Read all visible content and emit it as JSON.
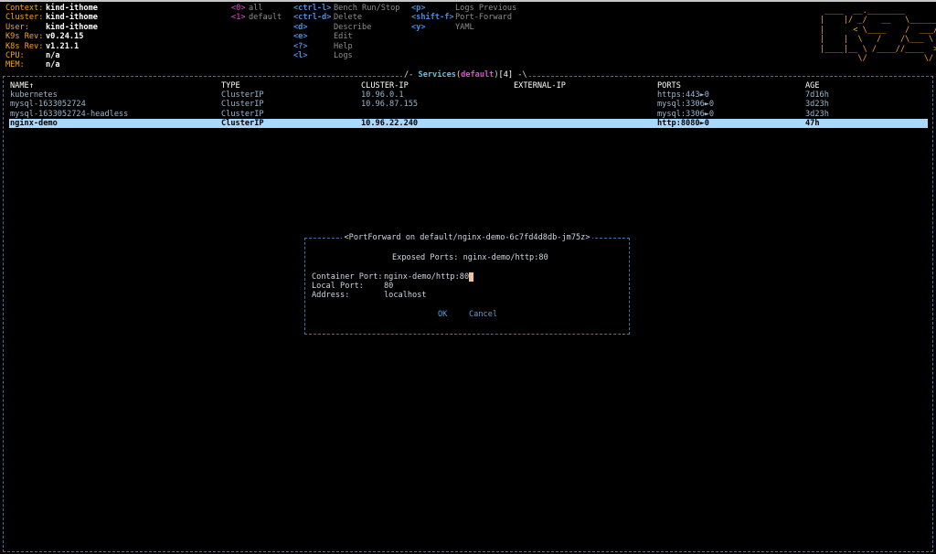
{
  "info": [
    {
      "label": "Context:",
      "value": "kind-ithome"
    },
    {
      "label": "Cluster:",
      "value": "kind-ithome"
    },
    {
      "label": "User:",
      "value": "kind-ithome"
    },
    {
      "label": "K9s Rev:",
      "value": "v0.24.15"
    },
    {
      "label": "K8s Rev:",
      "value": "v1.21.1"
    },
    {
      "label": "CPU:",
      "value": "n/a"
    },
    {
      "label": "MEM:",
      "value": "n/a"
    }
  ],
  "namespaces": [
    {
      "key": "<0>",
      "label": "all"
    },
    {
      "key": "<1>",
      "label": "default"
    }
  ],
  "shortcuts_col1": [
    {
      "key": "<ctrl-l>",
      "label": "Bench Run/Stop"
    },
    {
      "key": "<ctrl-d>",
      "label": "Delete"
    },
    {
      "key": "<d>",
      "label": "Describe"
    },
    {
      "key": "<e>",
      "label": "Edit"
    },
    {
      "key": "<?>",
      "label": "Help"
    },
    {
      "key": "<l>",
      "label": "Logs"
    }
  ],
  "shortcuts_col2": [
    {
      "key": "<p>",
      "label": "Logs Previous"
    },
    {
      "key": "<shift-f>",
      "label": "Port-Forward"
    },
    {
      "key": "<y>",
      "label": "YAML"
    }
  ],
  "logo": [
    " ____  __.________",
    "|    |/ _/   __   \\______",
    "|      < \\____    /  ___/",
    "|    |  \\   /    /\\___ \\",
    "|____|__ \\ /____//____  >",
    "        \\/            \\/"
  ],
  "view": {
    "resource": "Services",
    "namespace": "default",
    "count": "[4]"
  },
  "table": {
    "headers": [
      "NAME↑",
      "TYPE",
      "CLUSTER-IP",
      "EXTERNAL-IP",
      "PORTS",
      "AGE"
    ],
    "rows": [
      {
        "name": "kubernetes",
        "type": "ClusterIP",
        "cluster_ip": "10.96.0.1",
        "external_ip": "",
        "ports": "https:443►0",
        "age": "7d16h"
      },
      {
        "name": "mysql-1633052724",
        "type": "ClusterIP",
        "cluster_ip": "10.96.87.155",
        "external_ip": "",
        "ports": "mysql:3306►0",
        "age": "3d23h"
      },
      {
        "name": "mysql-1633052724-headless",
        "type": "ClusterIP",
        "cluster_ip": "",
        "external_ip": "",
        "ports": "mysql:3306►0",
        "age": "3d23h"
      },
      {
        "name": "nginx-demo",
        "type": "ClusterIP",
        "cluster_ip": "10.96.22.240",
        "external_ip": "",
        "ports": "http:8080►0",
        "age": "47h"
      }
    ],
    "selected_row": 3
  },
  "dialog": {
    "title": "<PortForward on default/nginx-demo-6c7fd4d8db-jm75z>",
    "exposed": "Exposed Ports: nginx-demo/http:80",
    "container_port_label": "Container Port:",
    "container_port_value": "nginx-demo/http:80",
    "local_port_label": "Local Port:",
    "local_port_value": "80",
    "address_label": "Address:",
    "address_value": "localhost",
    "ok_label": "OK",
    "cancel_label": "Cancel"
  },
  "colors": {
    "info_key": "#f5a623",
    "namespace_key": "#e24bd3",
    "shortcut_key": "#4f8bdc",
    "selection": "#a9d8ff",
    "frame": "#4a6ea8"
  }
}
